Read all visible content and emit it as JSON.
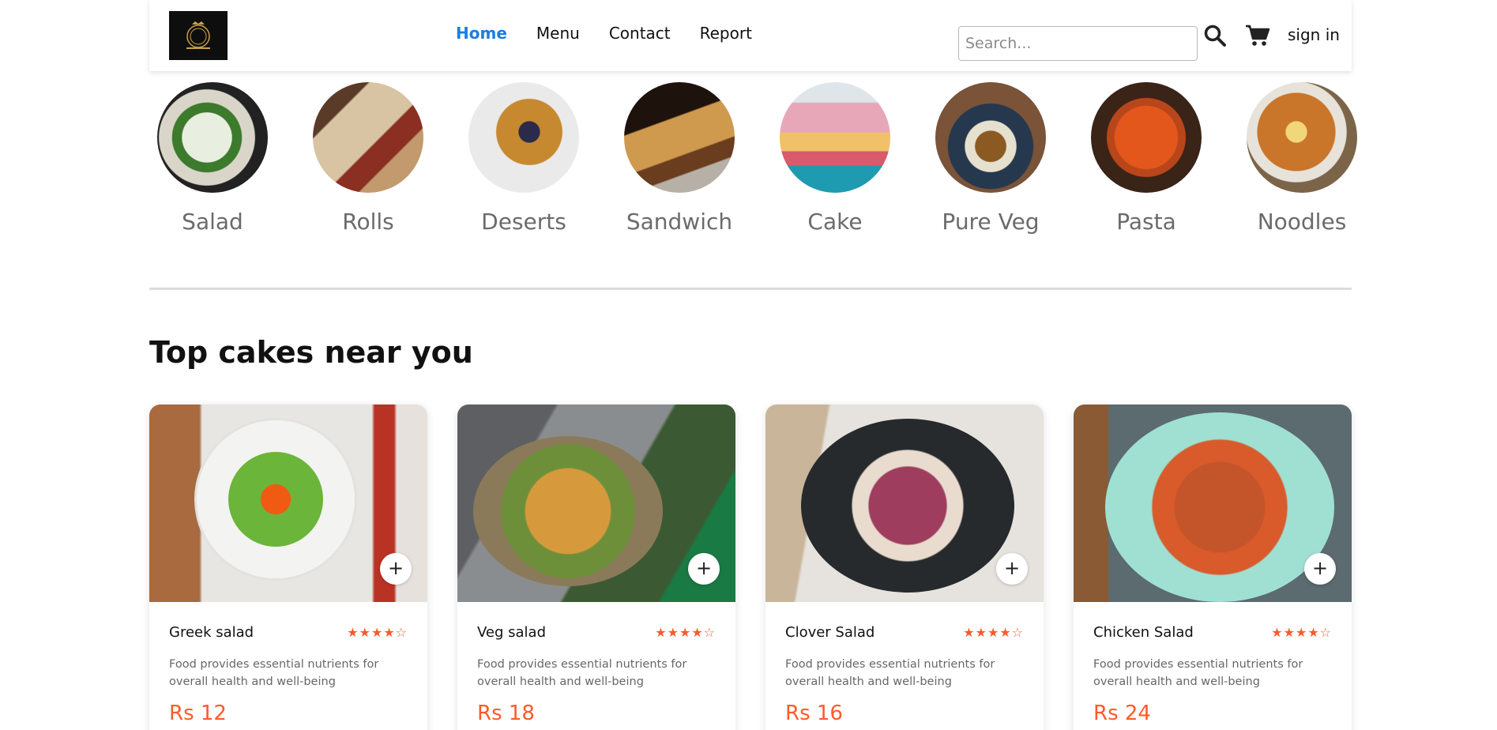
{
  "nav": {
    "links": [
      {
        "label": "Home",
        "active": true
      },
      {
        "label": "Menu",
        "active": false
      },
      {
        "label": "Contact",
        "active": false
      },
      {
        "label": "Report",
        "active": false
      }
    ],
    "search_placeholder": "Search...",
    "signin_label": "sign in"
  },
  "categories": [
    {
      "label": "Salad",
      "icon": "salad-image"
    },
    {
      "label": "Rolls",
      "icon": "rolls-image"
    },
    {
      "label": "Deserts",
      "icon": "deserts-image"
    },
    {
      "label": "Sandwich",
      "icon": "sandwich-image"
    },
    {
      "label": "Cake",
      "icon": "cake-image"
    },
    {
      "label": "Pure Veg",
      "icon": "pure-veg-image"
    },
    {
      "label": "Pasta",
      "icon": "pasta-image"
    },
    {
      "label": "Noodles",
      "icon": "noodles-image"
    }
  ],
  "section": {
    "title": "Top cakes near you"
  },
  "cards": [
    {
      "name": "Greek salad",
      "stars": "★★★★☆",
      "rating": 4,
      "desc": "Food provides essential nutrients for overall health and well-being",
      "price": "Rs 12",
      "add": "+"
    },
    {
      "name": "Veg salad",
      "stars": "★★★★☆",
      "rating": 4,
      "desc": "Food provides essential nutrients for overall health and well-being",
      "price": "Rs 18",
      "add": "+"
    },
    {
      "name": "Clover Salad",
      "stars": "★★★★☆",
      "rating": 4,
      "desc": "Food provides essential nutrients for overall health and well-being",
      "price": "Rs 16",
      "add": "+"
    },
    {
      "name": "Chicken Salad",
      "stars": "★★★★☆",
      "rating": 4,
      "desc": "Food provides essential nutrients for overall health and well-being",
      "price": "Rs 24",
      "add": "+"
    }
  ],
  "colors": {
    "accent": "#ff5a2a",
    "active_link": "#1a7fe0"
  }
}
